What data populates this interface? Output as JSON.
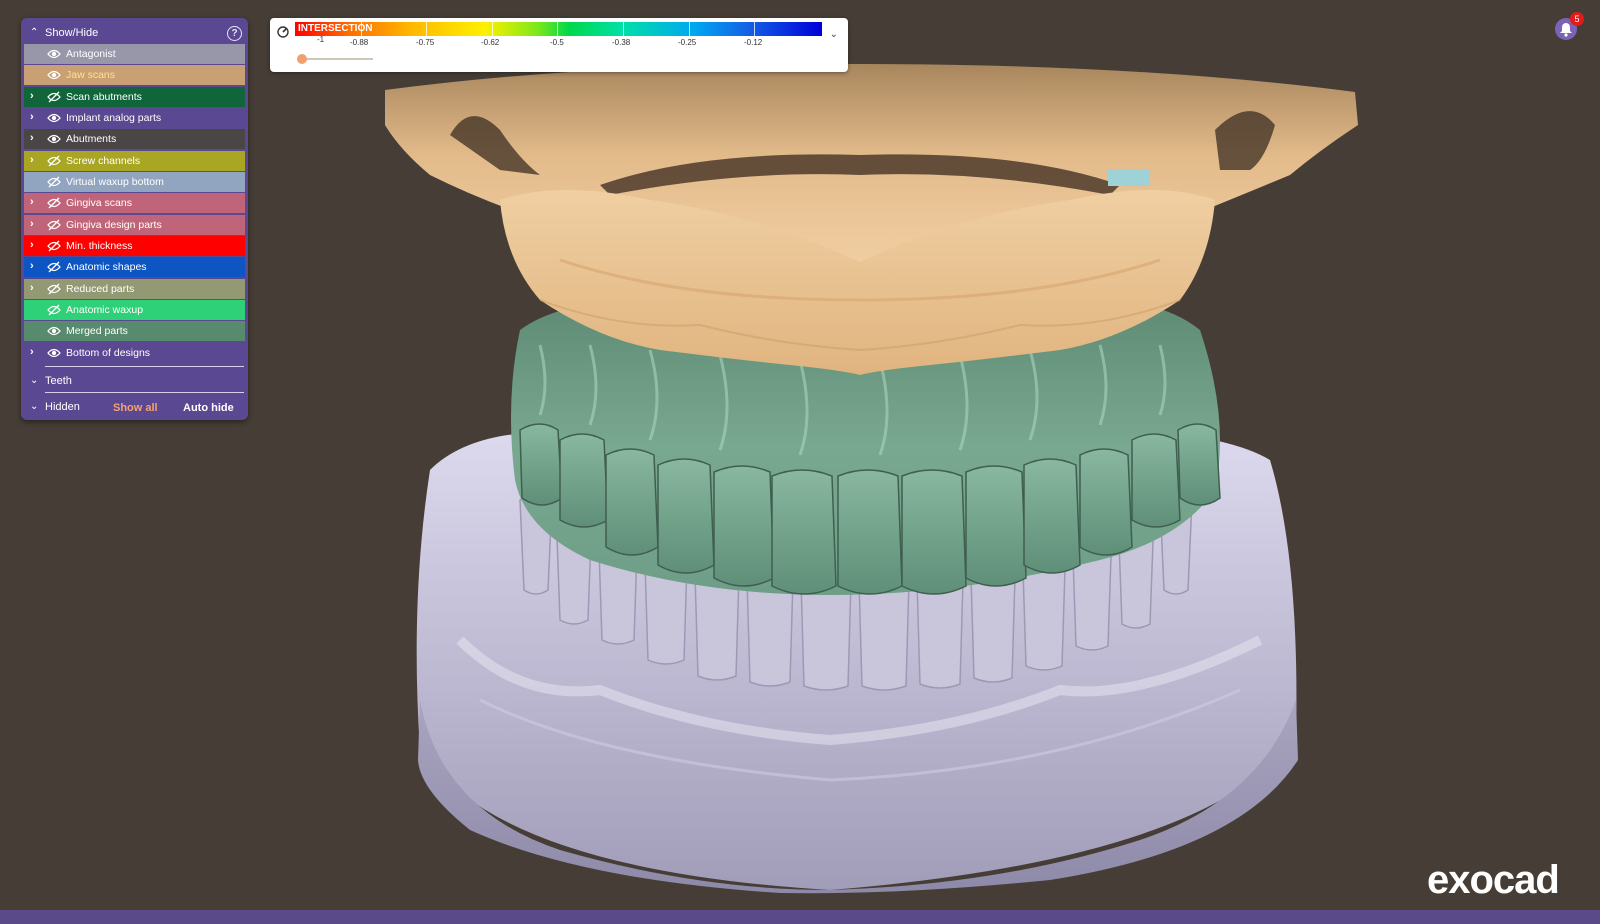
{
  "panel": {
    "title": "Show/Hide",
    "help_icon": "?",
    "layers": [
      {
        "label": "Antagonist",
        "expandable": false,
        "visible": true,
        "color": "#9896a9",
        "text_color": "#ffffff"
      },
      {
        "label": "Jaw scans",
        "expandable": false,
        "visible": true,
        "color": "#c9a074",
        "text_color": "#f9e38d"
      },
      {
        "label": "Scan abutments",
        "expandable": true,
        "visible": false,
        "color": "#10653a",
        "text_color": "#ffffff"
      },
      {
        "label": "Implant analog parts",
        "expandable": true,
        "visible": true,
        "color": "#5b4892",
        "text_color": "#ffffff"
      },
      {
        "label": "Abutments",
        "expandable": true,
        "visible": true,
        "color": "#4a4646",
        "text_color": "#ffffff"
      },
      {
        "label": "Screw channels",
        "expandable": true,
        "visible": false,
        "color": "#a9a624",
        "text_color": "#ffffff"
      },
      {
        "label": "Virtual waxup bottom",
        "expandable": false,
        "visible": false,
        "color": "#91a5c1",
        "text_color": "#ffffff"
      },
      {
        "label": "Gingiva scans",
        "expandable": true,
        "visible": false,
        "color": "#c06579",
        "text_color": "#ffffff"
      },
      {
        "label": "Gingiva design parts",
        "expandable": true,
        "visible": false,
        "color": "#c06579",
        "text_color": "#ffffff"
      },
      {
        "label": "Min. thickness",
        "expandable": true,
        "visible": false,
        "color": "#ff0000",
        "text_color": "#ffffff"
      },
      {
        "label": "Anatomic shapes",
        "expandable": true,
        "visible": false,
        "color": "#0d55c2",
        "text_color": "#ffffff"
      },
      {
        "label": "Reduced parts",
        "expandable": true,
        "visible": false,
        "color": "#939a73",
        "text_color": "#ffffff"
      },
      {
        "label": "Anatomic waxup",
        "expandable": false,
        "visible": false,
        "color": "#2ed178",
        "text_color": "#ffffff"
      },
      {
        "label": "Merged parts",
        "expandable": false,
        "visible": true,
        "color": "#588a6e",
        "text_color": "#ffffff"
      },
      {
        "label": "Bottom of designs",
        "expandable": true,
        "visible": true,
        "color": "#5b4892",
        "text_color": "#ffffff"
      }
    ],
    "teeth_label": "Teeth",
    "hidden_label": "Hidden",
    "show_all_label": "Show all",
    "auto_hide_label": "Auto hide"
  },
  "color_scale": {
    "name": "INTERSECTION",
    "labels": [
      "-1",
      "-0.88",
      "-0.75",
      "-0.62",
      "-0.5",
      "-0.38",
      "-0.25",
      "-0.12"
    ],
    "slider_value": 0
  },
  "notifications": {
    "count": "5"
  },
  "logo": "exocad",
  "icons": {
    "gauge": "gauge-icon",
    "visible": "eye-icon",
    "hidden": "eye-slash-icon",
    "expand": "chevron-right-icon",
    "bell": "bell-icon",
    "help": "help-icon"
  },
  "colors": {
    "background": "#463e36",
    "panel": "#5b4892",
    "accent": "#f0a071",
    "crown": "#6e9e87",
    "jaw": "#e2b889",
    "model": "#b9b6cc"
  }
}
